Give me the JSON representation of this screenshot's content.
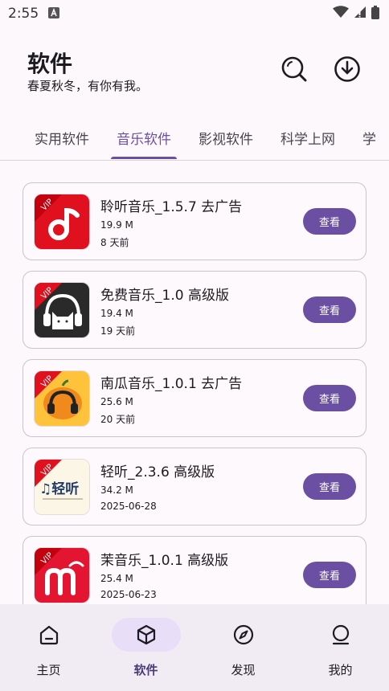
{
  "status": {
    "time": "2:55"
  },
  "header": {
    "title": "软件",
    "subtitle": "春夏秋冬，有你有我。"
  },
  "tabs": [
    {
      "label": "实用软件",
      "active": false
    },
    {
      "label": "音乐软件",
      "active": true
    },
    {
      "label": "影视软件",
      "active": false
    },
    {
      "label": "科学上网",
      "active": false
    },
    {
      "label": "学",
      "active": false
    }
  ],
  "apps": [
    {
      "name": "聆听音乐_1.5.7 去广告",
      "size": "19.9 M",
      "time": "8 天前",
      "button": "查看",
      "badge": "VIP",
      "icon": "music-note-icon"
    },
    {
      "name": "免费音乐_1.0 高级版",
      "size": "19.4 M",
      "time": "19 天前",
      "button": "查看",
      "badge": "VIP",
      "icon": "cat-headphones-icon"
    },
    {
      "name": "南瓜音乐_1.0.1 去广告",
      "size": "25.6 M",
      "time": "20 天前",
      "button": "查看",
      "badge": "VIP",
      "icon": "pumpkin-headphones-icon"
    },
    {
      "name": "轻听_2.3.6 高级版",
      "size": "34.2 M",
      "time": "2025-06-28",
      "button": "查看",
      "badge": "VIP",
      "icon": "qingting-logo-icon",
      "logo_text": "♫轻听"
    },
    {
      "name": "茉音乐_1.0.1 高级版",
      "size": "25.4 M",
      "time": "2025-06-23",
      "button": "查看",
      "badge": "VIP",
      "icon": "m-letter-icon"
    }
  ],
  "nav": [
    {
      "label": "主页",
      "icon": "home-icon",
      "active": false
    },
    {
      "label": "软件",
      "icon": "cube-icon",
      "active": true
    },
    {
      "label": "发现",
      "icon": "compass-icon",
      "active": false
    },
    {
      "label": "我的",
      "icon": "person-icon",
      "active": false
    }
  ],
  "colors": {
    "accent": "#6a4fa3",
    "nav_bg": "#f1ecf4",
    "pill": "#e8def8"
  }
}
